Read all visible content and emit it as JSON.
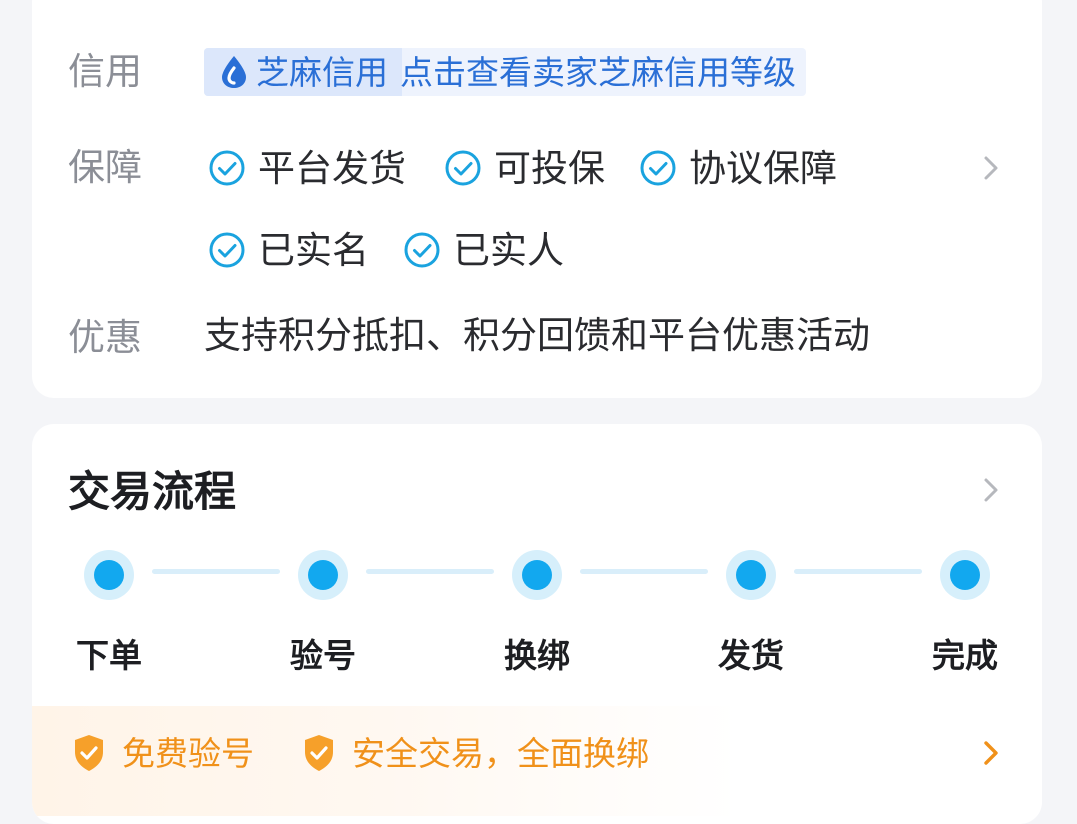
{
  "service": {
    "credit": {
      "label": "信用",
      "brand": "芝麻信用",
      "link_text": "点击查看卖家芝麻信用等级"
    },
    "guarantee": {
      "label": "保障",
      "tags": [
        "平台发货",
        "可投保",
        "协议保障",
        "已实名",
        "已实人"
      ]
    },
    "discount": {
      "label": "优惠",
      "text": "支持积分抵扣、积分回馈和平台优惠活动"
    }
  },
  "trade_flow": {
    "title": "交易流程",
    "steps": [
      "下单",
      "验号",
      "换绑",
      "发货",
      "完成"
    ],
    "benefits": [
      "免费验号",
      "安全交易，全面换绑"
    ]
  },
  "colors": {
    "accent_blue": "#12a8ef",
    "link_blue": "#2a6fd6",
    "check_cyan": "#1aa3df",
    "benefit_orange": "#f0911a"
  },
  "icons": {
    "credit": "sesame-credit-icon",
    "guarantee_tag": "check-circle-icon",
    "row_more": "chevron-right-icon",
    "benefit": "shield-check-icon"
  }
}
